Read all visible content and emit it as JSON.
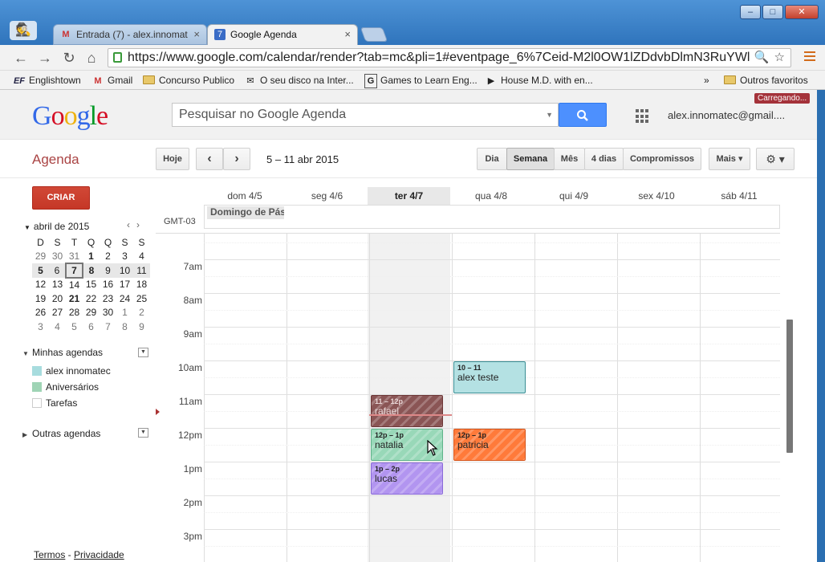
{
  "browser": {
    "tabs": [
      {
        "label": "Entrada (7) - alex.innomat"
      },
      {
        "label": "Google Agenda"
      }
    ],
    "url": "https://www.google.com/calendar/render?tab=mc&pli=1#eventpage_6%7Ceid-M2l0OW1lZDdvbDlmN3RuYWl",
    "bookmarks": [
      {
        "icon": "englishtown-icon",
        "label": "Englishtown"
      },
      {
        "icon": "gmail-icon",
        "label": "Gmail"
      },
      {
        "icon": "folder-icon",
        "label": "Concurso Publico"
      },
      {
        "icon": "mail-icon",
        "label": "O seu disco na Inter..."
      },
      {
        "icon": "games-icon",
        "label": "Games to Learn Eng..."
      },
      {
        "icon": "play-icon",
        "label": "House M.D. with en..."
      }
    ],
    "bookmarks_overflow": "»",
    "other_bookmarks": "Outros favoritos"
  },
  "header": {
    "search_placeholder": "Pesquisar no Google Agenda",
    "account": "alex.innomatec@gmail....",
    "loading": "Carregando..."
  },
  "subbar": {
    "title": "Agenda",
    "today": "Hoje",
    "date_range": "5 – 11 abr 2015",
    "views": [
      "Dia",
      "Semana",
      "Mês",
      "4 dias",
      "Compromissos"
    ],
    "selected_view": "Semana",
    "more": "Mais ▾",
    "settings": "⚙ ▾"
  },
  "sidebar": {
    "create": "CRIAR",
    "month": "abril de 2015",
    "weekdays": [
      "D",
      "S",
      "T",
      "Q",
      "Q",
      "S",
      "S"
    ],
    "weeks": [
      [
        "29",
        "30",
        "31",
        "1",
        "2",
        "3",
        "4"
      ],
      [
        "5",
        "6",
        "7",
        "8",
        "9",
        "10",
        "11"
      ],
      [
        "12",
        "13",
        "14",
        "15",
        "16",
        "17",
        "18"
      ],
      [
        "19",
        "20",
        "21",
        "22",
        "23",
        "24",
        "25"
      ],
      [
        "26",
        "27",
        "28",
        "29",
        "30",
        "1",
        "2"
      ],
      [
        "3",
        "4",
        "5",
        "6",
        "7",
        "8",
        "9"
      ]
    ],
    "my_calendars": "Minhas agendas",
    "calendars": [
      {
        "label": "alex innomatec",
        "color": "#a7dcde"
      },
      {
        "label": "Aniversários",
        "color": "#9fd4b5"
      },
      {
        "label": "Tarefas",
        "color": "#ffffff"
      }
    ],
    "other_calendars": "Outras agendas",
    "footer_terms": "Termos",
    "footer_sep": " - ",
    "footer_privacy": "Privacidade"
  },
  "calendar": {
    "timezone": "GMT-03",
    "columns": [
      "dom 4/5",
      "seg 4/6",
      "ter 4/7",
      "qua 4/8",
      "qui 4/9",
      "sex 4/10",
      "sáb 4/11"
    ],
    "today_column": "ter 4/7",
    "allday_event": "Domingo de Páscoa",
    "hours": [
      "7am",
      "8am",
      "9am",
      "10am",
      "11am",
      "12pm",
      "1pm",
      "2pm",
      "3pm"
    ],
    "events": [
      {
        "time": "10 – 11",
        "name": "alex teste",
        "day": "qua 4/8",
        "start": 10,
        "end": 11,
        "color": "#b4e1e3",
        "border": "#3b8e94"
      },
      {
        "time": "11 – 12p",
        "name": "rafael",
        "day": "ter 4/7",
        "start": 11,
        "end": 12,
        "color": "#8a5555",
        "border": "#6d3737"
      },
      {
        "time": "12p – 1p",
        "name": "natalia",
        "day": "ter 4/7",
        "start": 12,
        "end": 13,
        "color": "#98d8b8",
        "border": "#5fb38a"
      },
      {
        "time": "12p – 1p",
        "name": "patricia",
        "day": "qua 4/8",
        "start": 12,
        "end": 13,
        "color": "#ff7a3a",
        "border": "#d4541a"
      },
      {
        "time": "1p – 2p",
        "name": "lucas",
        "day": "ter 4/7",
        "start": 13,
        "end": 14,
        "color": "#b295f0",
        "border": "#8a6ad8"
      }
    ]
  }
}
